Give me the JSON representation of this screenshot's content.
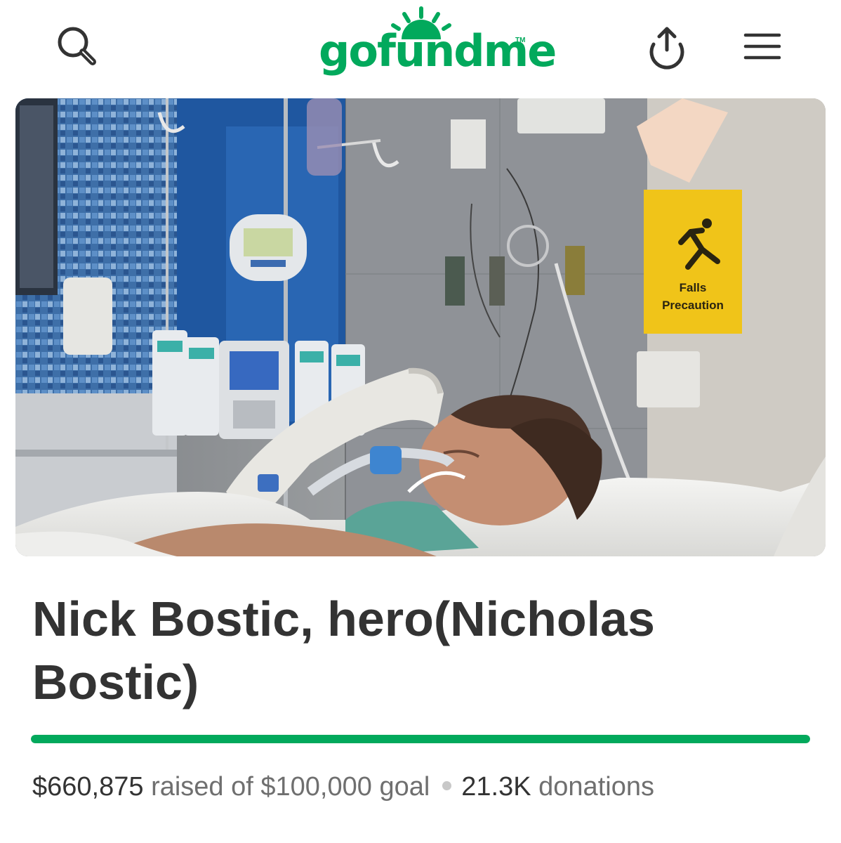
{
  "header": {
    "logo_text": "gofundme",
    "logo_tm": "TM",
    "brand_color": "#02a95c",
    "icons": {
      "search": "search-icon",
      "share": "share-upload-icon",
      "menu": "hamburger-menu-icon"
    }
  },
  "hero": {
    "photo": "hospital-room-photo",
    "sign_line1": "Falls",
    "sign_line2": "Precaution"
  },
  "campaign": {
    "title": "Nick Bostic, hero(Nicholas Bostic)",
    "progress_fraction": 1.0,
    "raised": "$660,875",
    "raised_of_text": "raised of",
    "goal": "$100,000",
    "goal_text": "goal",
    "donations_count": "21.3K",
    "donations_label": "donations"
  }
}
